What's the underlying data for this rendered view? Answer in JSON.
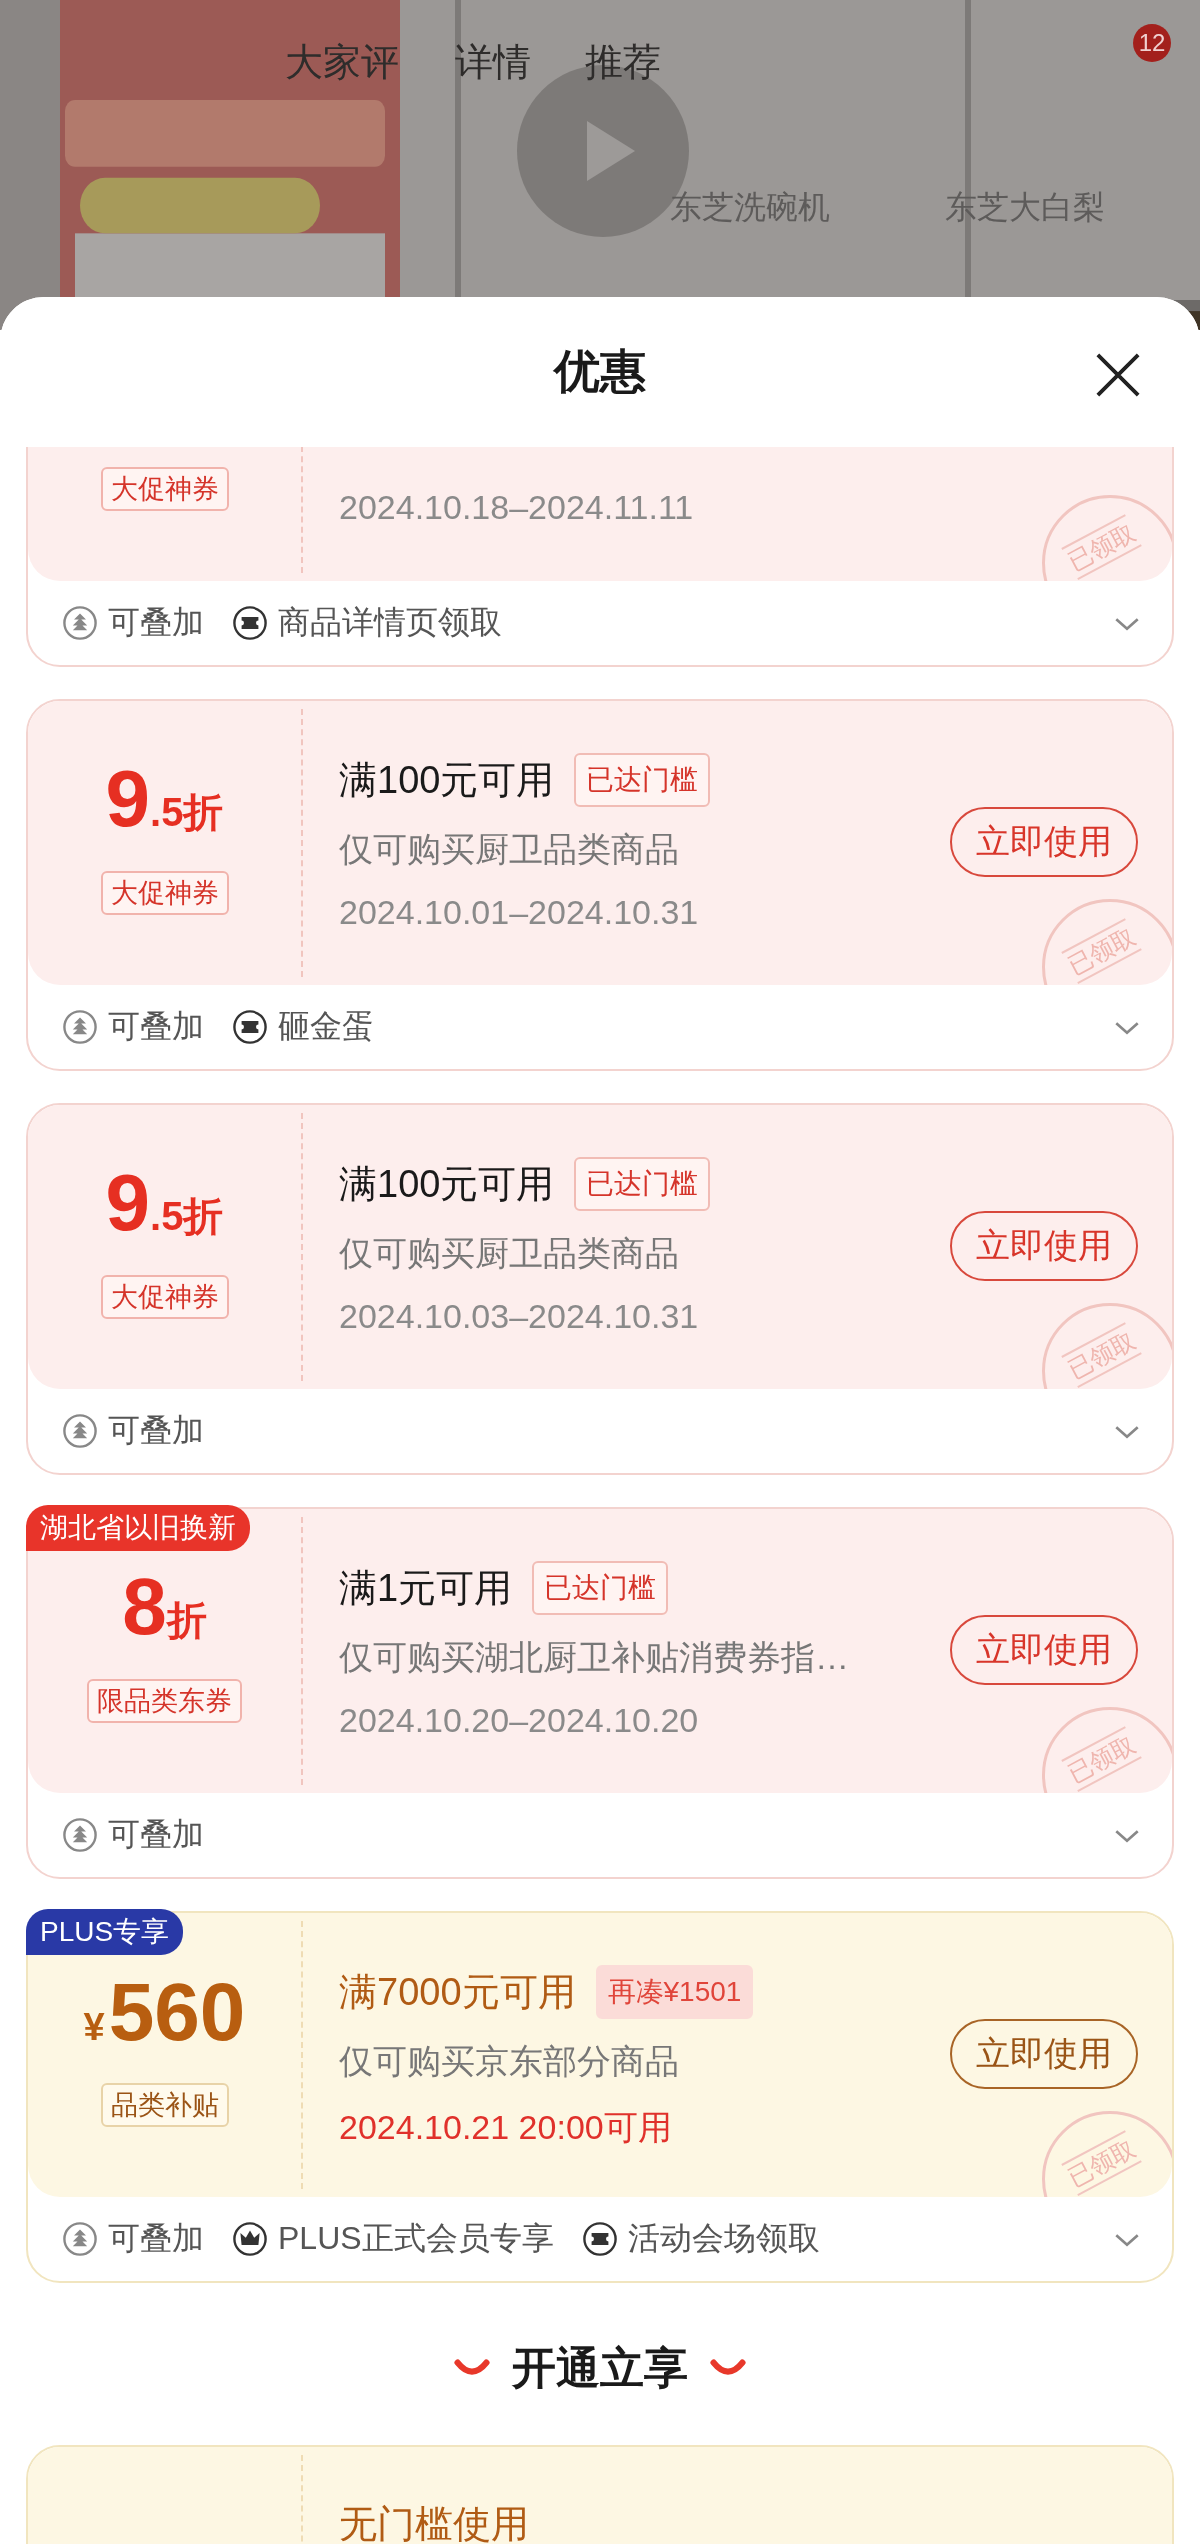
{
  "background_page": {
    "tabs": [
      {
        "label": "大家评"
      },
      {
        "label": "详情"
      },
      {
        "label": "推荐"
      }
    ],
    "badge": "12",
    "chips": [
      "东芝洗碗机",
      "东芝大白梨"
    ]
  },
  "sheet": {
    "title": "优惠"
  },
  "coupons": [
    {
      "kind": "standard",
      "cut_top": true,
      "tag": "大促神券",
      "date": "2024.10.18–2024.11.11",
      "stamp": "已领取",
      "features": [
        {
          "kind": "stack",
          "label": "可叠加"
        },
        {
          "kind": "ticket",
          "label": "商品详情页领取"
        }
      ]
    },
    {
      "kind": "standard",
      "amount": "9",
      "unit": ".5折",
      "tag": "大促神券",
      "condition": "满100元可用",
      "threshold": {
        "kind": "reached",
        "label": "已达门槛"
      },
      "description": "仅可购买厨卫品类商品",
      "date": "2024.10.01–2024.10.31",
      "button": "立即使用",
      "stamp": "已领取",
      "features": [
        {
          "kind": "stack",
          "label": "可叠加"
        },
        {
          "kind": "ticket",
          "label": "砸金蛋"
        }
      ]
    },
    {
      "kind": "standard",
      "amount": "9",
      "unit": ".5折",
      "tag": "大促神券",
      "condition": "满100元可用",
      "threshold": {
        "kind": "reached",
        "label": "已达门槛"
      },
      "description": "仅可购买厨卫品类商品",
      "date": "2024.10.03–2024.10.31",
      "button": "立即使用",
      "stamp": "已领取",
      "features": [
        {
          "kind": "stack",
          "label": "可叠加"
        }
      ]
    },
    {
      "kind": "standard",
      "corner": "湖北省以旧换新",
      "amount": "8",
      "unit": "折",
      "tag": "限品类东券",
      "condition": "满1元可用",
      "threshold": {
        "kind": "reached",
        "label": "已达门槛"
      },
      "description": "仅可购买湖北厨卫补贴消费券指…",
      "date": "2024.10.20–2024.10.20",
      "button": "立即使用",
      "stamp": "已领取",
      "features": [
        {
          "kind": "stack",
          "label": "可叠加"
        }
      ]
    },
    {
      "kind": "plus",
      "corner": "PLUS专享",
      "currency": "¥",
      "amount": "560",
      "tag": "品类补贴",
      "condition": "满7000元可用",
      "threshold": {
        "kind": "short",
        "label": "再凑¥1501"
      },
      "description": "仅可购买京东部分商品",
      "date": "2024.10.21 20:00可用",
      "button": "立即使用",
      "stamp": "已领取",
      "features": [
        {
          "kind": "stack",
          "label": "可叠加"
        },
        {
          "kind": "crown",
          "label": "PLUS正式会员专享"
        },
        {
          "kind": "ticket",
          "label": "活动会场领取"
        }
      ]
    }
  ],
  "section": {
    "title": "开通立享"
  },
  "extra_coupons": [
    {
      "kind": "plus",
      "condition": "无门槛使用"
    }
  ]
}
